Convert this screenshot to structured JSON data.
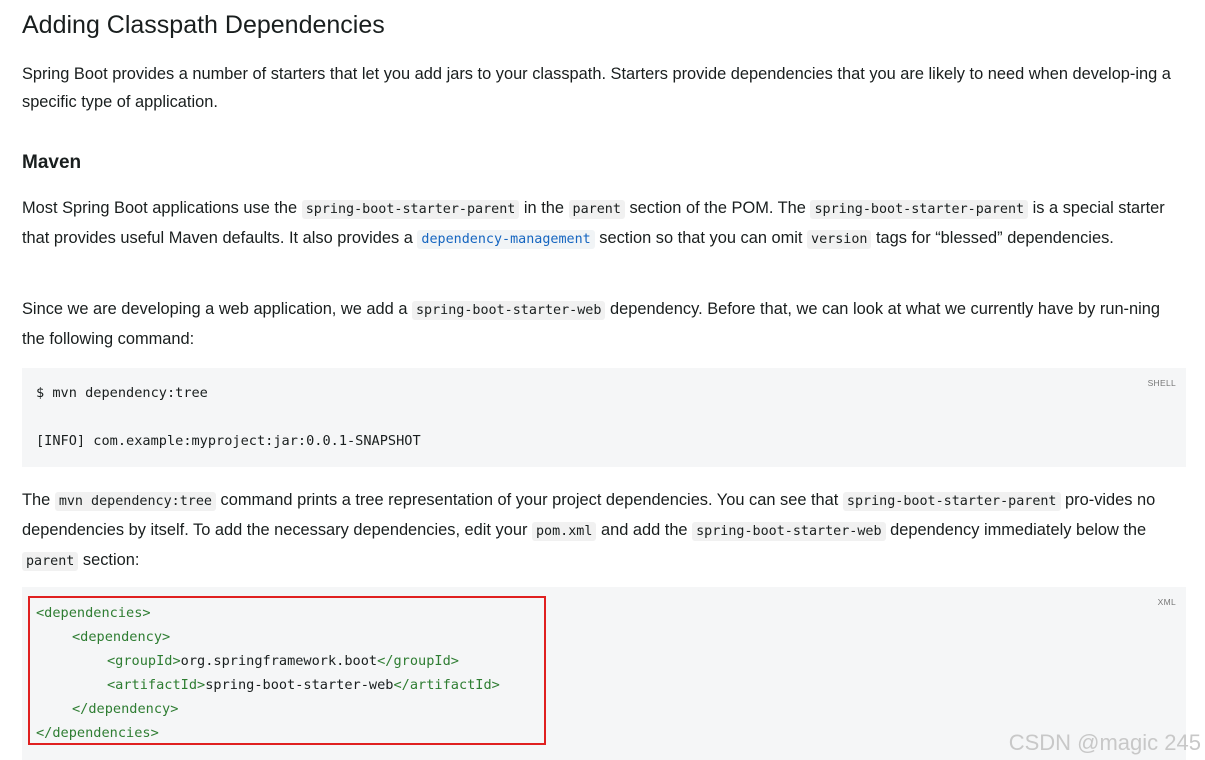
{
  "title": "Adding Classpath Dependencies",
  "intro": "Spring Boot provides a number of starters that let you add jars to your classpath. Starters provide dependencies that you are likely to need when develop-ing a specific type of application.",
  "maven_heading": "Maven",
  "para1": {
    "t1": "Most Spring Boot applications use the ",
    "c1": "spring-boot-starter-parent",
    "t2": " in the ",
    "c2": "parent",
    "t3": " section of the POM. The ",
    "c3": "spring-boot-starter-parent",
    "t4": " is a special starter that provides useful Maven defaults. It also provides a ",
    "c4": "dependency-management",
    "t5": " section so that you can omit ",
    "c5": "version",
    "t6": " tags for “blessed” dependencies."
  },
  "para2": {
    "t1": "Since we are developing a web application, we add a ",
    "c1": "spring-boot-starter-web",
    "t2": " dependency. Before that, we can look at what we currently have by run-ning the following command:"
  },
  "shell_block": {
    "lang": "SHELL",
    "line1": "$ mvn dependency:tree",
    "line2": "[INFO] com.example:myproject:jar:0.0.1-SNAPSHOT"
  },
  "para3": {
    "t1": "The ",
    "c1": "mvn dependency:tree",
    "t2": " command prints a tree representation of your project dependencies. You can see that ",
    "c2": "spring-boot-starter-parent",
    "t3": " pro-vides no dependencies by itself. To add the necessary dependencies, edit your ",
    "c3": "pom.xml",
    "t4": " and add the ",
    "c4": "spring-boot-starter-web",
    "t5": " dependency immediately below the ",
    "c5": "parent",
    "t6": " section:"
  },
  "xml_block": {
    "lang": "XML",
    "l1_tag": "<dependencies>",
    "l2_tag": "<dependency>",
    "l3_open": "<groupId>",
    "l3_val": "org.springframework.boot",
    "l3_close": "</groupId>",
    "l4_open": "<artifactId>",
    "l4_val": "spring-boot-starter-web",
    "l4_close": "</artifactId>",
    "l5_tag": "</dependency>",
    "l6_tag": "</dependencies>"
  },
  "watermark": "CSDN @magic 245",
  "colors": {
    "highlight_box": "#e02020",
    "xml_tag": "#2e7d32",
    "link_code": "#1565c0"
  }
}
